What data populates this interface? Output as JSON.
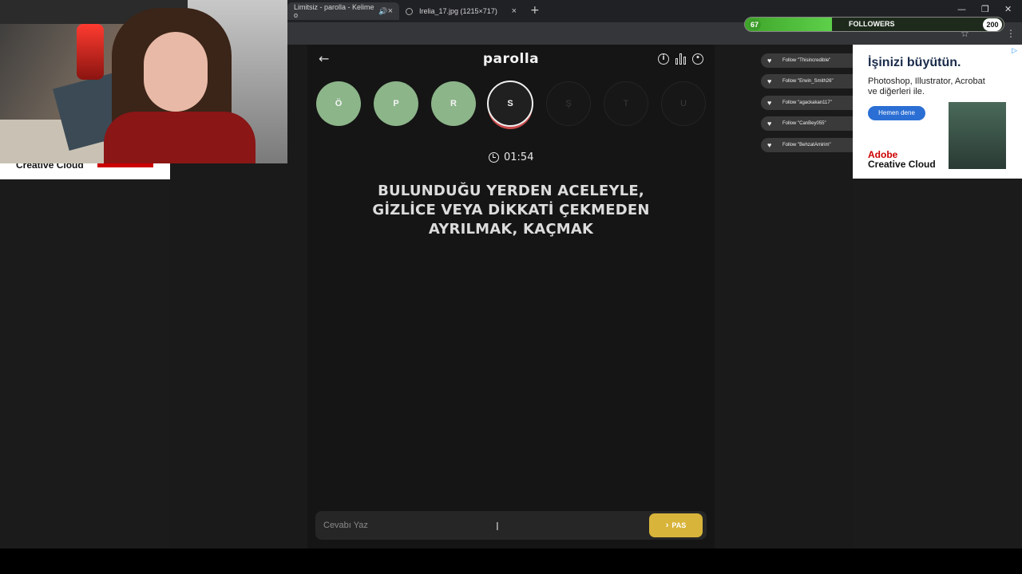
{
  "browser": {
    "tabs": [
      {
        "label": "Limitsiz - parolla - Kelime o"
      },
      {
        "label": "Irelia_17.jpg (1215×717)"
      }
    ],
    "new_tab_label": "+"
  },
  "app": {
    "title": "parolla",
    "letters": [
      {
        "char": "Ö",
        "state": "done"
      },
      {
        "char": "P",
        "state": "done"
      },
      {
        "char": "R",
        "state": "done"
      },
      {
        "char": "S",
        "state": "active"
      },
      {
        "char": "Ş",
        "state": "pending"
      },
      {
        "char": "T",
        "state": "pending"
      },
      {
        "char": "U",
        "state": "pending"
      }
    ],
    "timer": "01:54",
    "question_lines": [
      "BULUNDUĞU YERDEN ACELEYLE,",
      "GİZLİCE VEYA DİKKATİ ÇEKMEDEN",
      "AYRILMAK, KAÇMAK"
    ],
    "answer_placeholder": "Cevabı Yaz",
    "pass_label": "PAS",
    "colors": {
      "done": "#8cb58a",
      "pass": "#d8b43a",
      "active_ring": "#c94c4c"
    }
  },
  "stream": {
    "followers": {
      "current": "67",
      "label": "FOLLOWERS",
      "goal": "200",
      "progress": 0.335
    },
    "alerts": [
      "Follow \"Thisincredible\"",
      "Follow \"Erwin_Smith26\"",
      "Follow \"agackakan117\"",
      "Follow \"CanBey055\"",
      "Follow \"BehzatAmirim\""
    ]
  },
  "ads": {
    "left_brand": "Creative Cloud",
    "right_headline": "İşinizi büyütün.",
    "right_sub": "Photoshop, Illustrator, Acrobat ve diğerleri ile.",
    "right_cta": "Hemen dene",
    "right_brand_1": "Adobe",
    "right_brand_2": "Creative Cloud"
  }
}
